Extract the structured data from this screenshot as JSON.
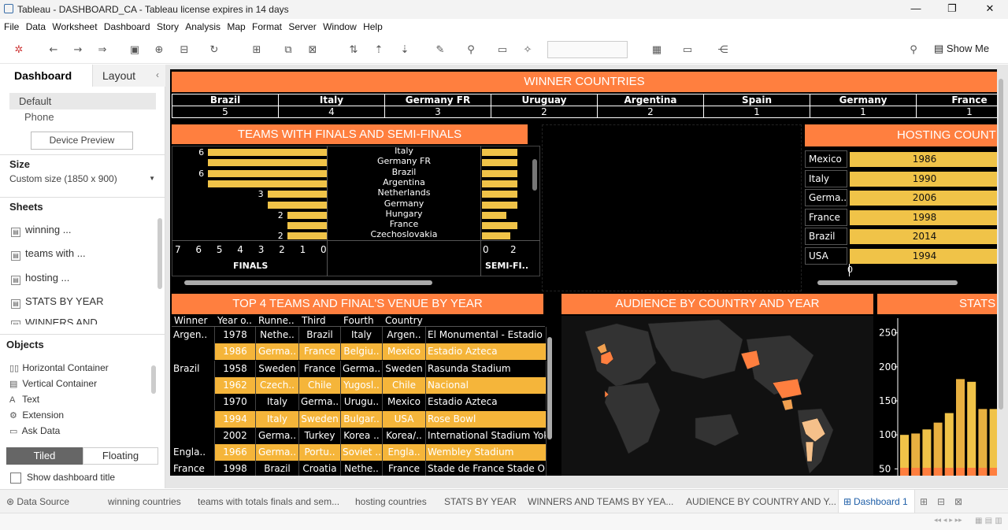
{
  "window": {
    "title": "Tableau - DASHBOARD_CA - Tableau license expires in 14 days",
    "min": "—",
    "restore": "❐",
    "close": "✕"
  },
  "menu": [
    "File",
    "Data",
    "Worksheet",
    "Dashboard",
    "Story",
    "Analysis",
    "Map",
    "Format",
    "Server",
    "Window",
    "Help"
  ],
  "toolbar": {
    "show_me": "Show Me"
  },
  "left": {
    "tab_dashboard": "Dashboard",
    "tab_layout": "Layout",
    "collapse": "‹",
    "device_default": "Default",
    "device_phone": "Phone",
    "device_preview": "Device Preview",
    "size_label": "Size",
    "size_value": "Custom size (1850 x 900)",
    "sheets_label": "Sheets",
    "sheets": [
      "winning ...",
      "teams with ...",
      "hosting ...",
      "STATS BY YEAR",
      "WINNERS AND"
    ],
    "objects_label": "Objects",
    "objects": [
      {
        "icon": "▯▯",
        "label": "Horizontal Container"
      },
      {
        "icon": "▤",
        "label": "Vertical Container"
      },
      {
        "icon": "A",
        "label": "Text"
      },
      {
        "icon": "⚙",
        "label": "Extension"
      },
      {
        "icon": "▭",
        "label": "Ask Data"
      }
    ],
    "tiled": "Tiled",
    "floating": "Floating",
    "show_title": "Show dashboard title"
  },
  "winner": {
    "title": "WINNER COUNTRIES",
    "countries": [
      "Brazil",
      "Italy",
      "Germany FR",
      "Uruguay",
      "Argentina",
      "Spain",
      "Germany",
      "France"
    ],
    "wins": [
      "5",
      "4",
      "3",
      "2",
      "2",
      "1",
      "1",
      "1"
    ]
  },
  "finals": {
    "title": "TEAMS WITH FINALS AND SEMI-FINALS",
    "countries": [
      "Italy",
      "Germany FR",
      "Brazil",
      "Argentina",
      "Netherlands",
      "Germany",
      "Hungary",
      "France",
      "Czechoslovakia"
    ],
    "finals_values": [
      6,
      6,
      6,
      6,
      3,
      3,
      2,
      2,
      2
    ],
    "finals_labels": [
      "6",
      "",
      "6",
      "",
      "3",
      "",
      "2",
      "",
      "2"
    ],
    "semi_values": [
      2,
      2,
      2,
      2,
      2,
      2,
      1.4,
      2,
      1.6
    ],
    "finals_axis": [
      "7",
      "6",
      "5",
      "4",
      "3",
      "2",
      "1",
      "0"
    ],
    "semi_axis": [
      "0",
      "2"
    ],
    "finals_label": "FINALS",
    "semi_label": "SEMI-FI..",
    "finals_max": 7,
    "semi_max": 2.5
  },
  "hosting": {
    "title": "HOSTING COUNT",
    "rows": [
      {
        "country": "Mexico",
        "year": "1986"
      },
      {
        "country": "Italy",
        "year": "1990"
      },
      {
        "country": "Germa..",
        "year": "2006"
      },
      {
        "country": "France",
        "year": "1998"
      },
      {
        "country": "Brazil",
        "year": "2014"
      },
      {
        "country": "USA",
        "year": "1994"
      }
    ],
    "axis_zero": "0"
  },
  "top4": {
    "title": "TOP 4 TEAMS AND FINAL'S VENUE BY YEAR",
    "headers": [
      "Winner",
      "Year o..",
      "Runne..",
      "Third",
      "Fourth",
      "Country",
      ""
    ],
    "rows": [
      {
        "winner": "Argen..",
        "year": "1978",
        "runner": "Nethe..",
        "third": "Brazil",
        "fourth": "Italy",
        "country": "Argen..",
        "venue": "El Monumental - Estadio M",
        "hl": false
      },
      {
        "winner": "",
        "year": "1986",
        "runner": "Germa..",
        "third": "France",
        "fourth": "Belgiu..",
        "country": "Mexico",
        "venue": "Estadio Azteca",
        "hl": true
      },
      {
        "winner": "Brazil",
        "year": "1958",
        "runner": "Sweden",
        "third": "France",
        "fourth": "Germa..",
        "country": "Sweden",
        "venue": "Rasunda Stadium",
        "hl": false
      },
      {
        "winner": "",
        "year": "1962",
        "runner": "Czech..",
        "third": "Chile",
        "fourth": "Yugosl..",
        "country": "Chile",
        "venue": "Nacional",
        "hl": true
      },
      {
        "winner": "",
        "year": "1970",
        "runner": "Italy",
        "third": "Germa..",
        "fourth": "Urugu..",
        "country": "Mexico",
        "venue": "Estadio Azteca",
        "hl": false
      },
      {
        "winner": "",
        "year": "1994",
        "runner": "Italy",
        "third": "Sweden",
        "fourth": "Bulgar..",
        "country": "USA",
        "venue": "Rose Bowl",
        "hl": true
      },
      {
        "winner": "",
        "year": "2002",
        "runner": "Germa..",
        "third": "Turkey",
        "fourth": "Korea ..",
        "country": "Korea/..",
        "venue": "International Stadium Yok",
        "hl": false
      },
      {
        "winner": "Engla..",
        "year": "1966",
        "runner": "Germa..",
        "third": "Portu..",
        "fourth": "Soviet ..",
        "country": "Engla..",
        "venue": "Wembley Stadium",
        "hl": true
      },
      {
        "winner": "France",
        "year": "1998",
        "runner": "Brazil",
        "third": "Croatia",
        "fourth": "Nethe..",
        "country": "France",
        "venue": "Stade de France  Stade Oly",
        "hl": false
      }
    ]
  },
  "audience": {
    "title": "AUDIENCE BY COUNTRY AND YEAR"
  },
  "stats": {
    "title": "STATS",
    "axis": [
      "250",
      "200",
      "150",
      "100",
      "50"
    ],
    "axis_max": 260,
    "axis_min": 40,
    "bars": [
      100,
      102,
      108,
      118,
      132,
      182,
      178,
      138,
      138
    ]
  },
  "tabs": [
    "Data Source",
    "winning countries",
    "teams with totals finals and sem...",
    "hosting countries",
    "STATS BY YEAR",
    "WINNERS AND TEAMS BY YEA...",
    "AUDIENCE BY COUNTRY AND Y...",
    "Dashboard 1"
  ],
  "colors": {
    "accent": "#ff7f3f",
    "bar": "#f0c348",
    "highlight_row": "#f5b53a",
    "background": "#000000"
  }
}
